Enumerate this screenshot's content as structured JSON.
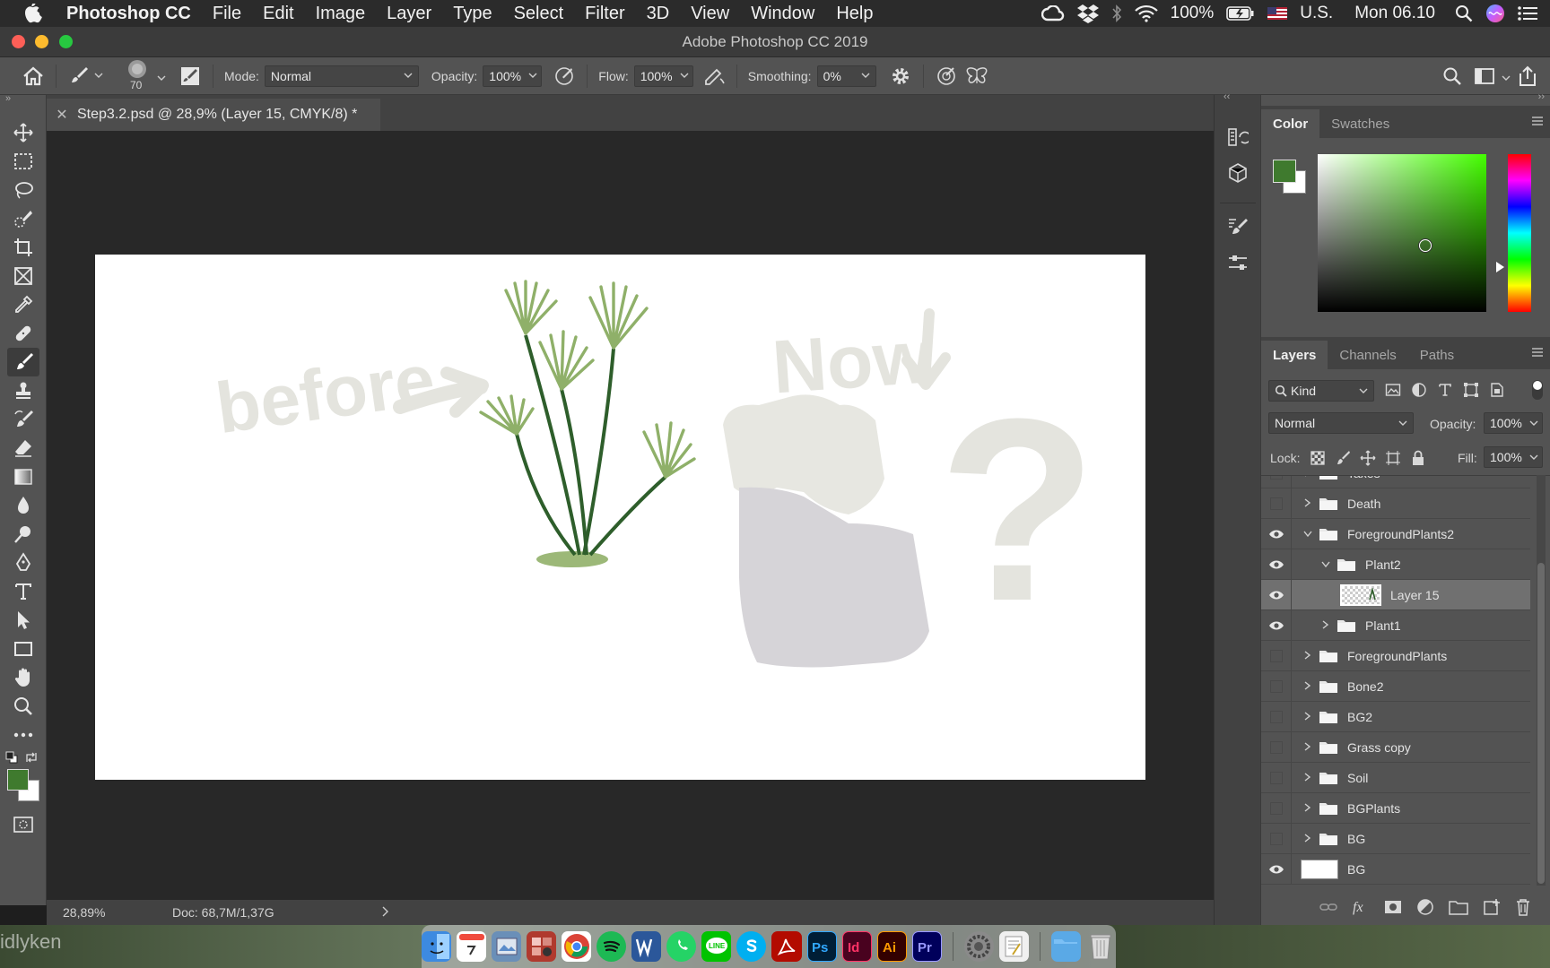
{
  "menubar": {
    "app_name": "Photoshop CC",
    "items": [
      "File",
      "Edit",
      "Image",
      "Layer",
      "Type",
      "Select",
      "Filter",
      "3D",
      "View",
      "Window",
      "Help"
    ],
    "battery": "100%",
    "input_source": "U.S.",
    "clock": "Mon 06.10"
  },
  "window": {
    "title": "Adobe Photoshop CC 2019"
  },
  "options": {
    "brush_size": "70",
    "mode_label": "Mode:",
    "mode_value": "Normal",
    "opacity_label": "Opacity:",
    "opacity_value": "100%",
    "flow_label": "Flow:",
    "flow_value": "100%",
    "smoothing_label": "Smoothing:",
    "smoothing_value": "0%"
  },
  "document": {
    "tab_title": "Step3.2.psd @ 28,9% (Layer 15, CMYK/8) *"
  },
  "status": {
    "zoom": "28,89%",
    "doc_size": "Doc: 68,7M/1,37G"
  },
  "color_panel": {
    "tabs": [
      "Color",
      "Swatches"
    ],
    "foreground": "#3f7a2e",
    "background": "#ffffff",
    "hue_base": "#44ff00"
  },
  "layers_panel": {
    "tabs": [
      "Layers",
      "Channels",
      "Paths"
    ],
    "filter_kind": "Kind",
    "blend_mode": "Normal",
    "opacity_label": "Opacity:",
    "opacity_value": "100%",
    "lock_label": "Lock:",
    "fill_label": "Fill:",
    "fill_value": "100%",
    "layers": [
      {
        "name": "Taxes",
        "visible": false,
        "type": "group",
        "indent": 0,
        "expanded": false
      },
      {
        "name": "Death",
        "visible": false,
        "type": "group",
        "indent": 0,
        "expanded": false
      },
      {
        "name": "ForegroundPlants2",
        "visible": true,
        "type": "group",
        "indent": 0,
        "expanded": true
      },
      {
        "name": "Plant2",
        "visible": true,
        "type": "group",
        "indent": 1,
        "expanded": true
      },
      {
        "name": "Layer 15",
        "visible": true,
        "type": "layer",
        "indent": 2,
        "selected": true
      },
      {
        "name": "Plant1",
        "visible": true,
        "type": "group",
        "indent": 1,
        "expanded": false
      },
      {
        "name": "ForegroundPlants",
        "visible": false,
        "type": "group",
        "indent": 0,
        "expanded": false
      },
      {
        "name": "Bone2",
        "visible": false,
        "type": "group",
        "indent": 0,
        "expanded": false
      },
      {
        "name": "BG2",
        "visible": false,
        "type": "group",
        "indent": 0,
        "expanded": false
      },
      {
        "name": "Grass copy",
        "visible": false,
        "type": "group",
        "indent": 0,
        "expanded": false
      },
      {
        "name": "Soil",
        "visible": false,
        "type": "group",
        "indent": 0,
        "expanded": false
      },
      {
        "name": "BGPlants",
        "visible": false,
        "type": "group",
        "indent": 0,
        "expanded": false
      },
      {
        "name": "BG",
        "visible": false,
        "type": "group",
        "indent": 0,
        "expanded": false
      },
      {
        "name": "BG",
        "visible": true,
        "type": "fill",
        "indent": 0
      }
    ]
  },
  "canvas": {
    "text_before": "before",
    "text_now": "Now",
    "text_question": "?"
  },
  "desktop": {
    "wallpaper_text": "idlyken"
  }
}
